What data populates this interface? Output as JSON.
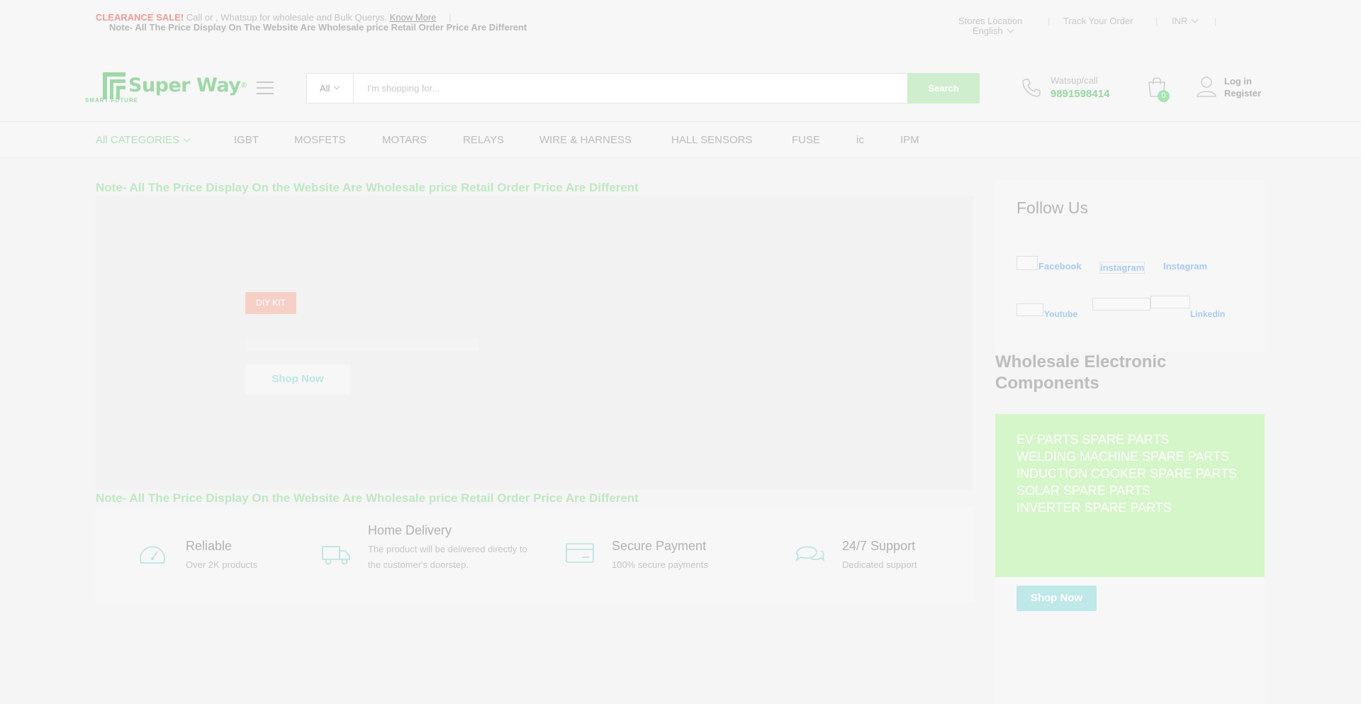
{
  "topbar": {
    "sale_label": "CLEARANCE SALE!",
    "sale_text": "Call or , Whatsup for wholesale and Bulk Querys.",
    "know_more": "Know More",
    "note": "Note- All The Price Display On The Website Are Wholesale price Retail Order Price Are Different",
    "stores_location": "Stores Location",
    "track_order": "Track Your Order",
    "currency": "INR",
    "language": "English"
  },
  "header": {
    "logo_text": "Super Way",
    "logo_tagline": "SMART FUTURE",
    "search": {
      "category": "All",
      "placeholder": "I'm shopping for...",
      "button": "Search"
    },
    "call_label": "Watsup/call",
    "call_number": "9891598414",
    "cart_count": "0",
    "login": "Log in",
    "register": "Register"
  },
  "nav": {
    "all_categories": "All CATEGORIES",
    "items": [
      "IGBT",
      "MOSFETS",
      "MOTARS",
      "RELAYS",
      "WIRE & HARNESS",
      "HALL SENSORS",
      "FUSE",
      "ic",
      "IPM"
    ]
  },
  "main": {
    "note_top": "Note- All The Price Display On the Website Are Wholesale price Retail Order Price Are Different",
    "hero_badge": "DIY KIT",
    "hero_button": "Shop Now",
    "note_bottom": "Note- All The Price Display On the Website Are Wholesale price Retail Order Price Are Different",
    "features": [
      {
        "title": "Reliable",
        "subtitle": "Over 2K products",
        "icon": "speedometer-icon"
      },
      {
        "title": "Home Delivery",
        "subtitle": "The product will be delivered directly to the customer's doorstep.",
        "icon": "truck-icon"
      },
      {
        "title": "Secure Payment",
        "subtitle": "100% secure payments",
        "icon": "credit-card-icon"
      },
      {
        "title": "24/7 Support",
        "subtitle": "Dedicated support",
        "icon": "chat-icon"
      }
    ]
  },
  "sidebar": {
    "follow_title": "Follow Us",
    "facebook": "Facebook",
    "instagram_alt": "instagram",
    "instagram": "Instagram",
    "youtube": "Youtube",
    "linkedin": "Linkedin",
    "wholesale_title": "Wholesale Electronic Components",
    "parts": [
      "EV PARTS SPARE PARTS",
      "WELDING MACHINE SPARE PARTS",
      "INDUCTION COOKER SPARE PARTS",
      "SOLAR SPARE PARTS",
      "INVERTER SPARE PARTS"
    ],
    "shop_button": "Shop Now"
  },
  "colors": {
    "accent_green": "#9fd8a8",
    "sale_red": "#f19a96",
    "link_blue": "#a9cbf0",
    "promo_green": "#d5f6c8"
  }
}
